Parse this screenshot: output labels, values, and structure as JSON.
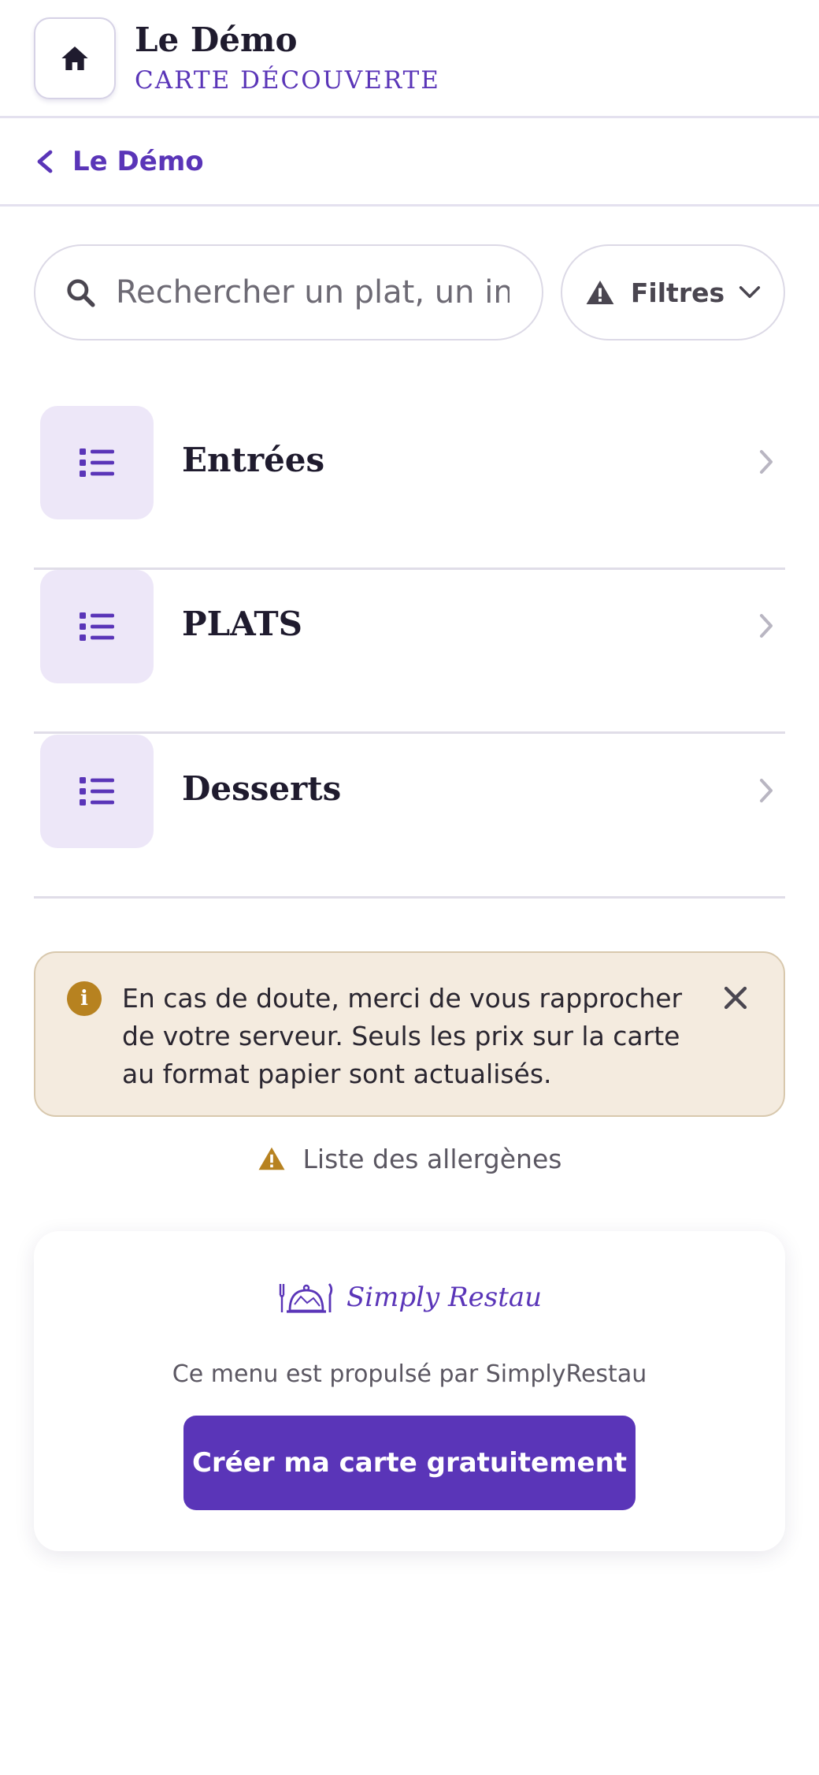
{
  "header": {
    "title": "Le Démo",
    "subtitle": "CARTE DÉCOUVERTE",
    "home_icon": "home-icon"
  },
  "breadcrumb": {
    "back_label": "Le Démo"
  },
  "search": {
    "placeholder": "Rechercher un plat, un ingrédient",
    "value": ""
  },
  "filters": {
    "label": "Filtres"
  },
  "categories": [
    {
      "label": "Entrées",
      "icon": "list-icon"
    },
    {
      "label": "PLATS",
      "icon": "list-icon"
    },
    {
      "label": "Desserts",
      "icon": "list-icon"
    }
  ],
  "notice": {
    "text": "En cas de doute, merci de vous rapprocher de votre serveur. Seuls les prix sur la carte au format papier sont actualisés."
  },
  "allergens": {
    "label": "Liste des allergènes"
  },
  "footer": {
    "brand_name": "Simply Restau",
    "powered_by": "Ce menu est propulsé par SimplyRestau",
    "cta_label": "Créer ma carte gratuitement"
  },
  "colors": {
    "accent": "#5a35b8",
    "category_icon_bg": "#ede7f8",
    "notice_bg": "#f4ebdf",
    "notice_icon": "#b78220"
  }
}
